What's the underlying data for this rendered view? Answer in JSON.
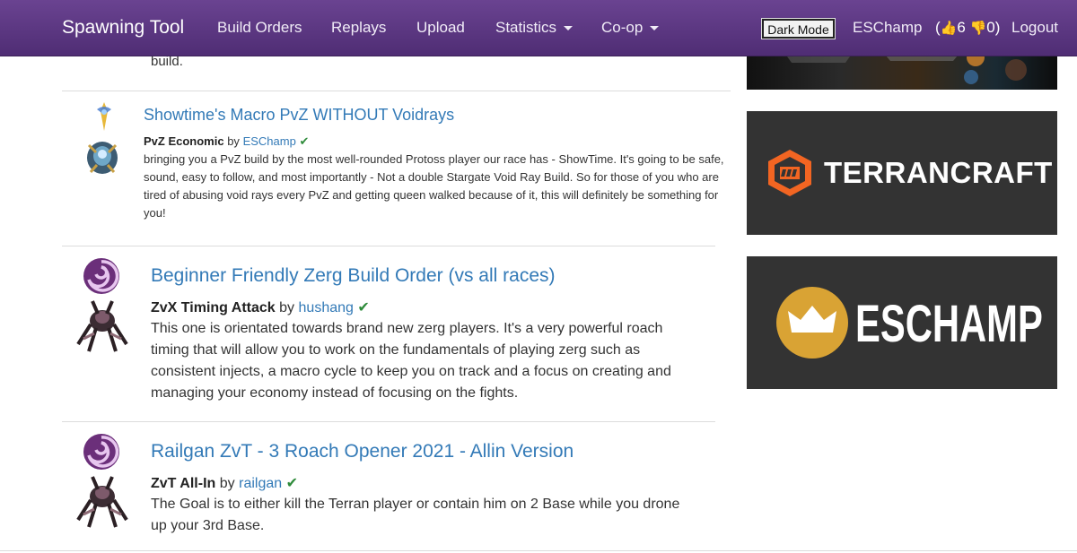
{
  "nav": {
    "brand": "Spawning Tool",
    "build_orders": "Build Orders",
    "replays": "Replays",
    "upload": "Upload",
    "statistics": "Statistics",
    "coop": "Co-op",
    "dark_mode": "Dark Mode",
    "user": "ESChamp",
    "votes_up": "6",
    "votes_down": "0",
    "votes_open": "(",
    "votes_close": ")",
    "logout": "Logout"
  },
  "previous_entry_tail": "build.",
  "entries": [
    {
      "title": "Showtime's Macro PvZ WITHOUT Voidrays",
      "category": "PvZ Economic",
      "by": "by",
      "author": "ESChamp",
      "description": "bringing you a PvZ build by the most well-rounded Protoss player our race has - ShowTime. It's going to be safe, sound, easy to follow, and most importantly - Not a double Stargate Void Ray Build. So for those of you who are tired of abusing void rays every PvZ and getting queen walked because of it, this will definitely be something for you!",
      "race_icon": "protoss-icon",
      "unit_icon": "protoss-unit-icon"
    },
    {
      "title": "Beginner Friendly Zerg Build Order (vs all races)",
      "category": "ZvX Timing Attack",
      "by": "by",
      "author": "hushang",
      "description": "This one is orientated towards brand new zerg players. It's a very powerful roach timing that will allow you to work on the fundamentals of playing zerg such as consistent injects, a macro cycle to keep you on track and a focus on creating and managing your economy instead of focusing on the fights.",
      "race_icon": "zerg-icon",
      "unit_icon": "zerg-unit-icon"
    },
    {
      "title": "Railgan ZvT - 3 Roach Opener 2021 - Allin Version",
      "category": "ZvT All-In",
      "by": "by",
      "author": "railgan",
      "description": "The Goal is to either kill the Terran player or contain him on 2 Base while you drone up your 3rd Base.",
      "race_icon": "zerg-icon",
      "unit_icon": "zerg-unit-icon"
    }
  ],
  "sidebar": {
    "terrancraft": "TERRANCRAFT",
    "eschamp": "ESCHAMP"
  },
  "colors": {
    "nav_purple": "#5b3782",
    "link_blue": "#337ab7",
    "check_green": "#2e8b3a",
    "terrancraft_orange": "#f26522",
    "eschamp_gold": "#d9a334",
    "banner_bg": "#333333"
  }
}
